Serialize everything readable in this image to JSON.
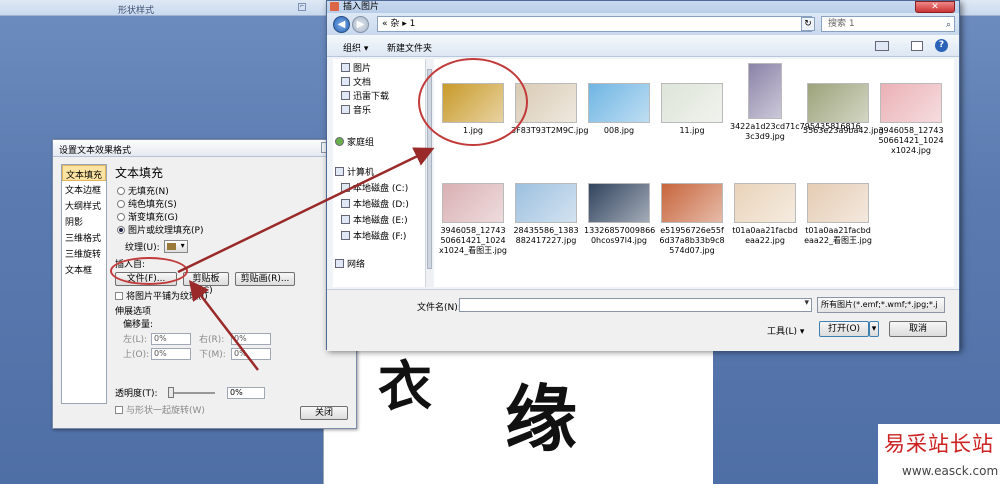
{
  "ribbon": {
    "group_label": "形状样式",
    "launcher": "⌐"
  },
  "document": {
    "char1": "衣",
    "char2": "缘"
  },
  "watermark": {
    "title": "易采站长站",
    "url": "www.easck.com"
  },
  "format_dialog": {
    "title": "设置文本效果格式",
    "help": "?",
    "close": "×",
    "nav": [
      "文本填充",
      "文本边框",
      "大纲样式",
      "阴影",
      "三维格式",
      "三维旋转",
      "文本框"
    ],
    "heading": "文本填充",
    "fill_options": [
      "无填充(N)",
      "纯色填充(S)",
      "渐变填充(G)",
      "图片或纹理填充(P)"
    ],
    "texture_label": "纹理(U):",
    "insert_from": "插入自:",
    "file_btn": "文件(F)...",
    "clipboard_btn": "剪贴板(C)",
    "clipart_btn": "剪贴画(R)...",
    "tile_check": "将图片平铺为纹理(I)",
    "stretch_options": "伸展选项",
    "offset_label": "偏移量:",
    "left_label": "左(L):",
    "right_label": "右(R):",
    "top_label": "上(O):",
    "bottom_label": "下(M):",
    "offset_value": "0%",
    "transparency_label": "透明度(T):",
    "transparency_value": "0%",
    "rotate_check": "与形状一起旋转(W)",
    "close_btn": "关闭"
  },
  "file_dialog": {
    "title": "插入图片",
    "close": "✕",
    "address": "« 杂 ▸ 1",
    "search_placeholder": "搜索 1",
    "organize": "组织 ▾",
    "new_folder": "新建文件夹",
    "sidebar": [
      {
        "label": "图片",
        "icon": "pictures-icon"
      },
      {
        "label": "文档",
        "icon": "documents-icon"
      },
      {
        "label": "迅雷下载",
        "icon": "download-icon"
      },
      {
        "label": "音乐",
        "icon": "music-icon"
      },
      {
        "label": "家庭组",
        "icon": "homegroup-icon"
      },
      {
        "label": "计算机",
        "icon": "computer-icon"
      },
      {
        "label": "本地磁盘 (C:)",
        "icon": "drive-icon"
      },
      {
        "label": "本地磁盘 (D:)",
        "icon": "drive-icon"
      },
      {
        "label": "本地磁盘 (E:)",
        "icon": "drive-icon"
      },
      {
        "label": "本地磁盘 (F:)",
        "icon": "drive-icon"
      },
      {
        "label": "网络",
        "icon": "network-icon"
      }
    ],
    "files": [
      {
        "name": "1.jpg",
        "color": "#c99a2a"
      },
      {
        "name": "3F83T93T2M9C.jpg",
        "color": "#d9cbb4"
      },
      {
        "name": "008.jpg",
        "color": "#6fb5e3"
      },
      {
        "name": "11.jpg",
        "color": "#dde4d8"
      },
      {
        "name": "3422a1d23cd71c795435816816 3c3d9.jpg",
        "color": "#8b83a8"
      },
      {
        "name": "5563e23a9ba42.jpg",
        "color": "#9ca37a"
      },
      {
        "name": "3946058_12743 50661421_1024 x1024.jpg",
        "color": "#eab1b6"
      },
      {
        "name": "3946058_12743 50661421_1024 x1024_看图王.jpg",
        "color": "#d9b0b3"
      },
      {
        "name": "28435586_1383 882417227.jpg",
        "color": "#9cc0df"
      },
      {
        "name": "13326857009866 0hcos97l4.jpg",
        "color": "#31445e"
      },
      {
        "name": "e51956726e55f 6d37a8b33b9c8 574d07.jpg",
        "color": "#c7653c"
      },
      {
        "name": "t01a0aa21facbd eaa22.jpg",
        "color": "#e9d3b9"
      },
      {
        "name": "t01a0aa21facbd eaa22_看图王.jpg",
        "color": "#e5ccb4"
      }
    ],
    "filename_label": "文件名(N):",
    "filetype": "所有图片(*.emf;*.wmf;*.jpg;*.j",
    "tools": "工具(L) ▾",
    "open_btn": "打开(O)",
    "cancel_btn": "取消"
  }
}
